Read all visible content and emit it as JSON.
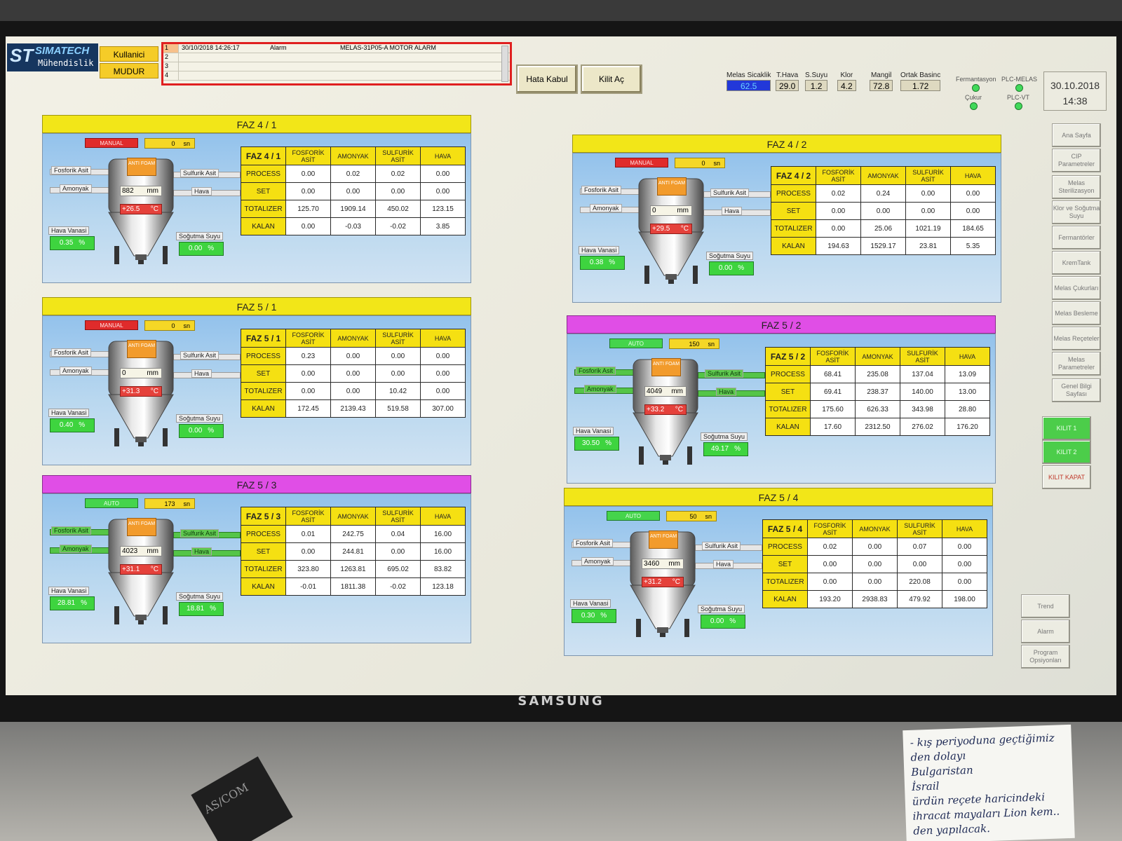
{
  "header": {
    "logo": {
      "mark": "ST",
      "name": "SIMATECH",
      "sub": "Mühendislik"
    },
    "user_label": "Kullanici",
    "user_name": "MUDUR",
    "alarm": {
      "rows": [
        {
          "num": "1",
          "time": "30/10/2018    14:26:17",
          "kind": "Alarm",
          "message": "MELAS-31P05-A MOTOR ALARM"
        },
        {
          "num": "2",
          "time": "",
          "kind": "",
          "message": ""
        },
        {
          "num": "3",
          "time": "",
          "kind": "",
          "message": ""
        },
        {
          "num": "4",
          "time": "",
          "kind": "",
          "message": ""
        }
      ]
    },
    "ack_button": "Hata Kabul",
    "unlock_button": "Kilit Aç",
    "metrics": [
      {
        "label": "Melas Sicaklik",
        "value": "62.5",
        "style": "blue"
      },
      {
        "label": "T.Hava",
        "value": "29.0",
        "style": ""
      },
      {
        "label": "S.Suyu",
        "value": "1.2",
        "style": ""
      },
      {
        "label": "Klor",
        "value": "4.2",
        "style": ""
      },
      {
        "label": "Mangil",
        "value": "72.8",
        "style": ""
      },
      {
        "label": "Ortak Basinc",
        "value": "1.72",
        "style": ""
      }
    ],
    "status": [
      {
        "label": "Fermantasyon"
      },
      {
        "label": "PLC-MELAS"
      },
      {
        "label": "Çukur"
      },
      {
        "label": "PLC-VT"
      }
    ],
    "date": "30.10.2018",
    "time": "14:38"
  },
  "nav": [
    "Ana Sayfa",
    "CIP Parametreler",
    "Melas Sterilizasyon",
    "Klor ve Soğutma Suyu",
    "Fermantörler",
    "KremTank",
    "Melas Çukurları",
    "Melas Besleme",
    "Melas Reçeteler",
    "Melas Parametreler",
    "Genel Bilgi Sayfası",
    "KILIT 1",
    "KILIT 2",
    "KILIT KAPAT",
    "Trend",
    "Alarm",
    "Program Opsiyonları"
  ],
  "columns": [
    "FOSFORİK ASİT",
    "AMONYAK",
    "SULFURİK ASİT",
    "HAVA"
  ],
  "rows_labels": [
    "PROCESS",
    "SET",
    "TOTALIZER",
    "KALAN"
  ],
  "pipes": {
    "fosforik": "Fosforik Asit",
    "amonyak": "Amonyak",
    "sulfurik": "Sulfurik Asit",
    "hava": "Hava"
  },
  "tank_labels": {
    "antifoam": "ANTI FOAM",
    "valve": "Hava Vanasi",
    "cooling": "Soğutma Suyu",
    "timer_unit": "sn",
    "level_unit": "mm",
    "temp_unit": "°C",
    "pct_unit": "%"
  },
  "panels": [
    {
      "title": "FAZ 4 / 1",
      "color": "yellow",
      "mode": "MANUAL",
      "timer": "0",
      "level": "882",
      "temp": "+26.5",
      "valve": "0.35",
      "cooling": "0.00",
      "pipes_active": false,
      "table": [
        [
          "0.00",
          "0.02",
          "0.02",
          "0.00"
        ],
        [
          "0.00",
          "0.00",
          "0.00",
          "0.00"
        ],
        [
          "125.70",
          "1909.14",
          "450.02",
          "123.15"
        ],
        [
          "0.00",
          "-0.03",
          "-0.02",
          "3.85"
        ]
      ]
    },
    {
      "title": "FAZ 4 / 2",
      "color": "yellow",
      "mode": "MANUAL",
      "timer": "0",
      "level": "0",
      "temp": "+29.5",
      "valve": "0.38",
      "cooling": "0.00",
      "pipes_active": false,
      "table": [
        [
          "0.02",
          "0.24",
          "0.00",
          "0.00"
        ],
        [
          "0.00",
          "0.00",
          "0.00",
          "0.00"
        ],
        [
          "0.00",
          "25.06",
          "1021.19",
          "184.65"
        ],
        [
          "194.63",
          "1529.17",
          "23.81",
          "5.35"
        ]
      ]
    },
    {
      "title": "FAZ 5 / 1",
      "color": "yellow",
      "mode": "MANUAL",
      "timer": "0",
      "level": "0",
      "temp": "+31.3",
      "valve": "0.40",
      "cooling": "0.00",
      "pipes_active": false,
      "table": [
        [
          "0.23",
          "0.00",
          "0.00",
          "0.00"
        ],
        [
          "0.00",
          "0.00",
          "0.00",
          "0.00"
        ],
        [
          "0.00",
          "0.00",
          "10.42",
          "0.00"
        ],
        [
          "172.45",
          "2139.43",
          "519.58",
          "307.00"
        ]
      ]
    },
    {
      "title": "FAZ 5 / 2",
      "color": "magenta",
      "mode": "AUTO",
      "timer": "150",
      "level": "4049",
      "temp": "+33.2",
      "valve": "30.50",
      "cooling": "49.17",
      "pipes_active": true,
      "table": [
        [
          "68.41",
          "235.08",
          "137.04",
          "13.09"
        ],
        [
          "69.41",
          "238.37",
          "140.00",
          "13.00"
        ],
        [
          "175.60",
          "626.33",
          "343.98",
          "28.80"
        ],
        [
          "17.60",
          "2312.50",
          "276.02",
          "176.20"
        ]
      ]
    },
    {
      "title": "FAZ 5 / 3",
      "color": "magenta",
      "mode": "AUTO",
      "timer": "173",
      "level": "4023",
      "temp": "+31.1",
      "valve": "28.81",
      "cooling": "18.81",
      "pipes_active": true,
      "table": [
        [
          "0.01",
          "242.75",
          "0.04",
          "16.00"
        ],
        [
          "0.00",
          "244.81",
          "0.00",
          "16.00"
        ],
        [
          "323.80",
          "1263.81",
          "695.02",
          "83.82"
        ],
        [
          "-0.01",
          "1811.38",
          "-0.02",
          "123.18"
        ]
      ]
    },
    {
      "title": "FAZ 5 / 4",
      "color": "yellow",
      "mode": "AUTO",
      "timer": "50",
      "level": "3460",
      "temp": "+31.2",
      "valve": "0.30",
      "cooling": "0.00",
      "pipes_active": false,
      "table": [
        [
          "0.02",
          "0.00",
          "0.07",
          "0.00"
        ],
        [
          "0.00",
          "0.00",
          "0.00",
          "0.00"
        ],
        [
          "0.00",
          "0.00",
          "220.08",
          "0.00"
        ],
        [
          "193.20",
          "2938.83",
          "479.92",
          "198.00"
        ]
      ]
    }
  ],
  "monitor_brand": "SAMSUNG",
  "sticky_note": [
    "- kış periyoduna geçtiğimiz",
    "den dolayı",
    "Bulgaristan",
    "İsrail",
    "ürdün reçete haricindeki",
    "ihracat mayaları Lion kem..",
    "den yapılacak."
  ],
  "desk_label": "AS/COM"
}
